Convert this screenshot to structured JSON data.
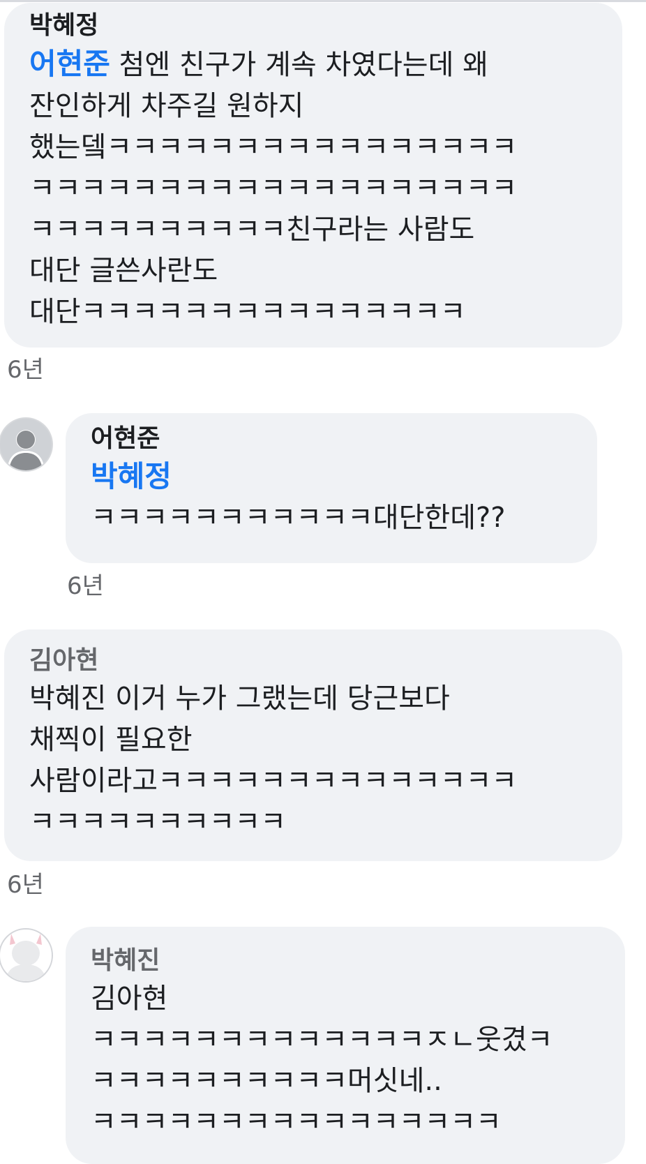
{
  "comments": [
    {
      "author": "박혜정",
      "mention": "어현준",
      "first_line_rest": " 첨엔 친구가 계속 차였다는데 왜",
      "lines": [
        "잔인하게 차주길 원하지",
        "했는뎈ㅋㅋㅋㅋㅋㅋㅋㅋㅋㅋㅋㅋㅋㅋㅋㅋ",
        "ㅋㅋㅋㅋㅋㅋㅋㅋㅋㅋㅋㅋㅋㅋㅋㅋㅋㅋㅋ",
        "ㅋㅋㅋㅋㅋㅋㅋㅋㅋㅋ친구라는 사람도",
        "대단 글쓴사란도",
        "대단ㅋㅋㅋㅋㅋㅋㅋㅋㅋㅋㅋㅋㅋㅋㅋ"
      ],
      "time": "6년"
    },
    {
      "author": "어현준",
      "mention": "박혜정",
      "lines": [
        "ㅋㅋㅋㅋㅋㅋㅋㅋㅋㅋㅋ대단한데??"
      ],
      "time": "6년"
    },
    {
      "author": "김아현",
      "lines": [
        "박혜진 이거 누가 그랬는데  당근보다",
        "채찍이 필요한",
        "사람이라고ㅋㅋㅋㅋㅋㅋㅋㅋㅋㅋㅋㅋㅋㅋ",
        "ㅋㅋㅋㅋㅋㅋㅋㅋㅋㅋ"
      ],
      "time": "6년"
    },
    {
      "author": "박혜진",
      "lines": [
        "김아현",
        "ㅋㅋㅋㅋㅋㅋㅋㅋㅋㅋㅋㅋㅋㅈㄴ웃겼ㅋ",
        "ㅋㅋㅋㅋㅋㅋㅋㅋㅋㅋ머싯네..",
        "ㅋㅋㅋㅋㅋㅋㅋㅋㅋㅋㅋㅋㅋㅋㅋㅋ"
      ]
    }
  ]
}
